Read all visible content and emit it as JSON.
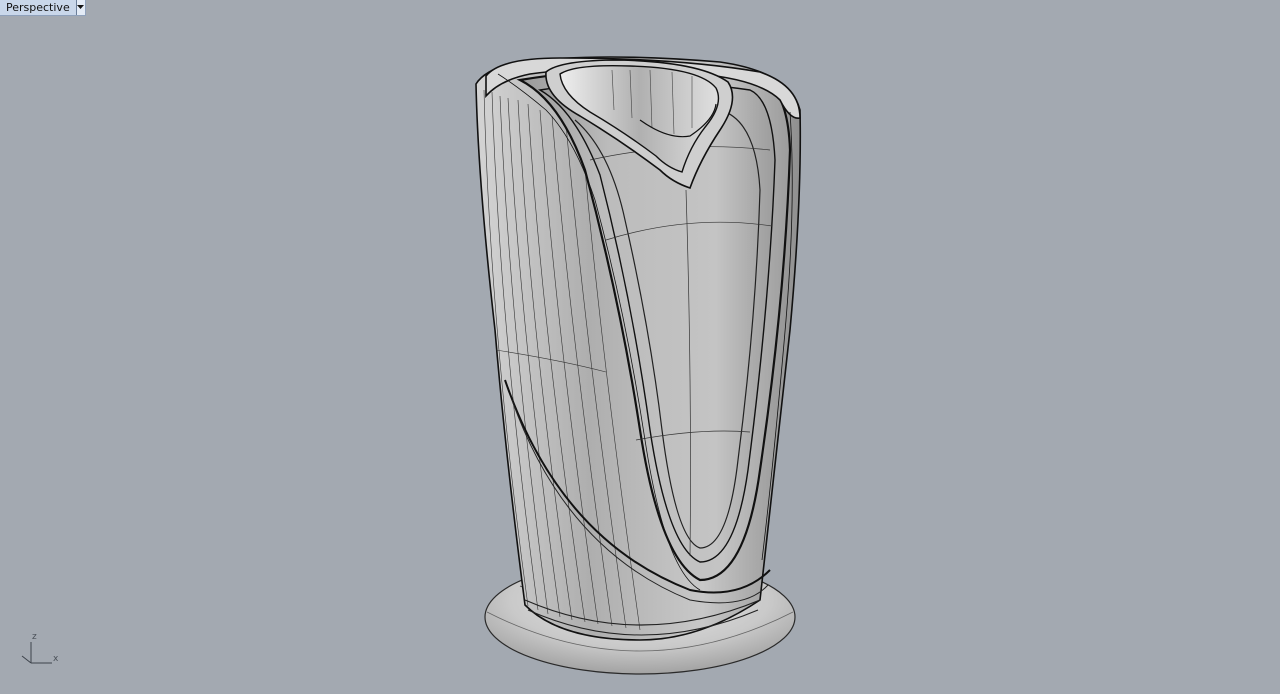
{
  "viewport": {
    "title": "Perspective",
    "menu_icon": "chevron-down-icon",
    "background": "#a3a9b1"
  },
  "axes": {
    "z_label": "z",
    "x_label": "x"
  },
  "model": {
    "description_icon": "vase-3d-model",
    "surface_color": "#b9b9b9",
    "wire_color": "#1a1a1a"
  }
}
